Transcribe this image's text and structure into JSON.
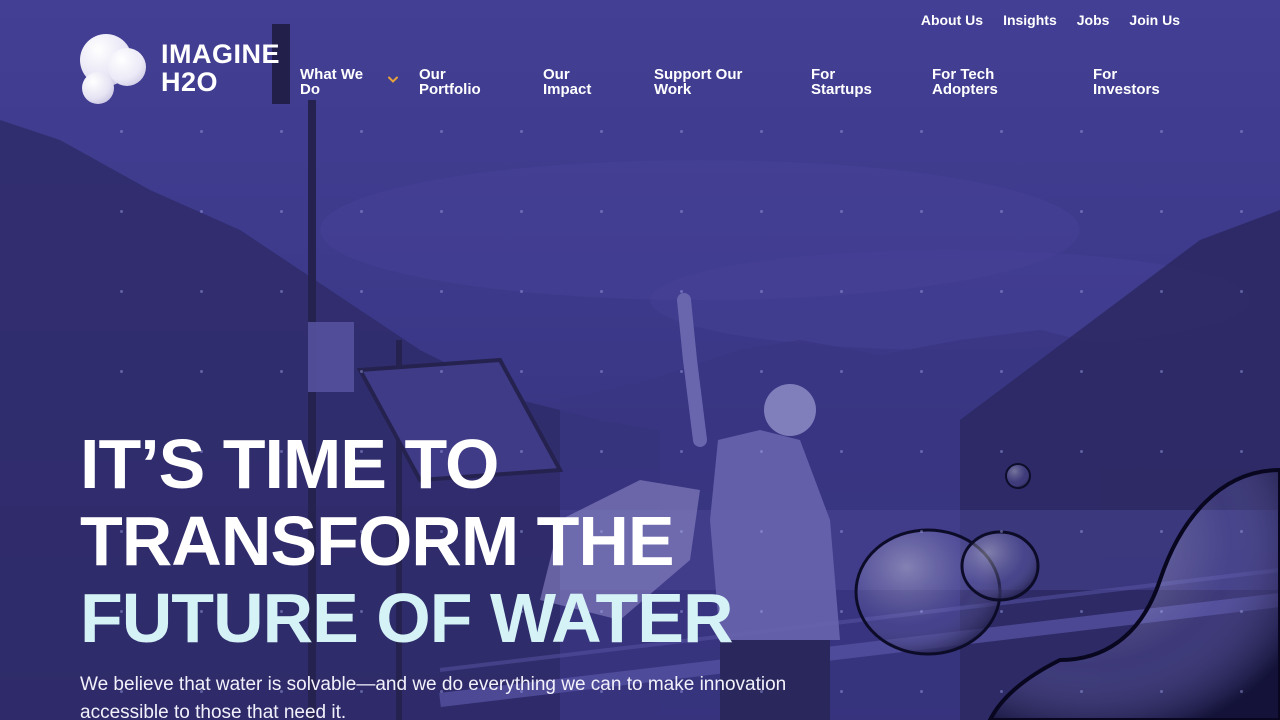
{
  "brand": {
    "logo_text_line1": "IMAGINE",
    "logo_text_line2": "H2O"
  },
  "top_links": [
    "About Us",
    "Insights",
    "Jobs",
    "Join Us"
  ],
  "main_nav": [
    {
      "label": "What We Do",
      "has_dropdown": true
    },
    {
      "label": "Our Portfolio"
    },
    {
      "label": "Our Impact"
    },
    {
      "label": "Support Our Work"
    },
    {
      "label": "For Startups"
    },
    {
      "label": "For Tech Adopters"
    },
    {
      "label": "For Investors"
    }
  ],
  "hero": {
    "title_line1": "IT’S TIME TO",
    "title_line2": "TRANSFORM THE",
    "title_line3": "FUTURE OF WATER",
    "subtitle": "We believe that water is solvable—and we do everything we can to make innovation accessible to those that need it."
  },
  "colors": {
    "background": "#3d3a8a",
    "accent_text": "#d5f3f7",
    "dropdown_chevron": "#e8a23a",
    "text": "#ffffff"
  },
  "icons": {
    "dropdown": "chevron-down-icon",
    "logo": "bubbles-logo-icon"
  }
}
